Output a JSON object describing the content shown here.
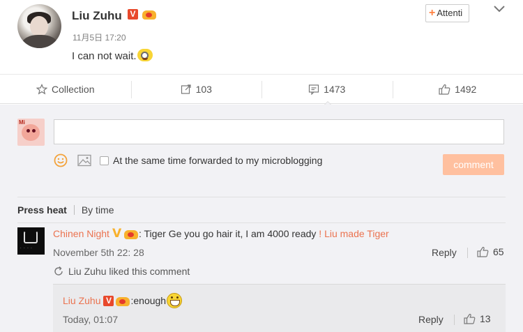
{
  "post": {
    "author": "Liu Zuhu",
    "verified_badge": "V",
    "time": "11月5日 17:20",
    "text": "I can not wait.",
    "follow_label": "Attenti"
  },
  "actions": {
    "collection_label": "Collection",
    "repost_count": "103",
    "comment_count": "1473",
    "like_count": "1492"
  },
  "composer": {
    "placeholder": "",
    "forward_label": "At the same time forwarded to my microblogging",
    "submit_label": "comment",
    "avatar_text": "Mi"
  },
  "sort": {
    "active": "Press heat",
    "other": "By time"
  },
  "comment": {
    "author": "Chinen Night",
    "text_before": ": Tiger Ge you go hair it, I am 4000 ready ",
    "text_highlight": "! Liu made Tiger",
    "time": "November 5th 22: 28",
    "reply_label": "Reply",
    "like_count": "65",
    "liked_note_name": "Liu Zuhu liked",
    "liked_note_suffix": "this comment"
  },
  "reply": {
    "author": "Liu Zuhu",
    "verified_badge": "V",
    "text": ":enough",
    "time": "Today, 01:07",
    "reply_label": "Reply",
    "like_count": "13"
  },
  "colors": {
    "accent": "#eb7350",
    "verified": "#e8492c",
    "comment_button": "#ffc09f",
    "background_panel": "#f2f2f5"
  },
  "icons": [
    "chevron-down-icon",
    "star-icon",
    "repost-icon",
    "comment-icon",
    "thumbs-up-icon",
    "smile-icon",
    "image-icon",
    "refresh-icon"
  ]
}
